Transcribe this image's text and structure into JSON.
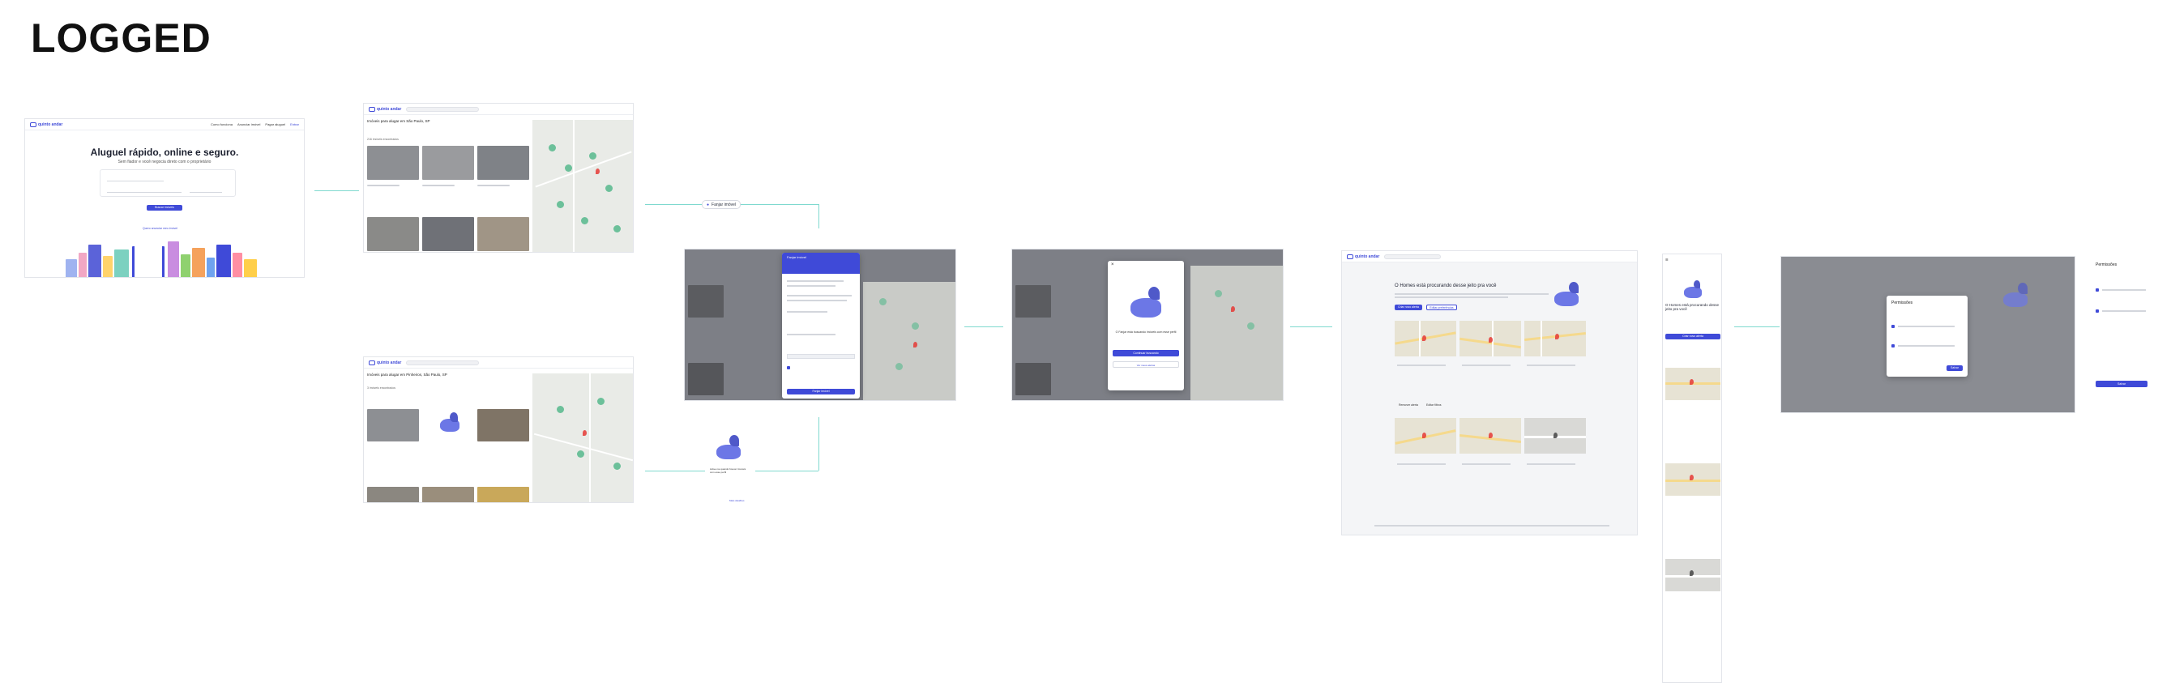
{
  "board": {
    "title": "LOGGED"
  },
  "brand": {
    "logo_text": "quinto andar"
  },
  "landing": {
    "nav": [
      "Como funciona",
      "Anunciar imóvel",
      "Pagar aluguel",
      "Entrar"
    ],
    "hero_title": "Aluguel rápido, online e seguro.",
    "hero_subtitle": "Sem fiador e você negocia direto com o proprietário",
    "cta": "Buscar imóveis",
    "link": "Quero anunciar meu imóvel"
  },
  "listing": {
    "title_a": "Imóveis para alugar em São Paulo, SP",
    "title_b": "Imóveis para alugar em Pinheiros, São Paulo, SP",
    "results_a": "216 imóveis encontrados",
    "results_b": "3 imóveis encontrados"
  },
  "fanpair_tag": {
    "label": "Fanjar imóvel"
  },
  "dog_card": {
    "text": "Avise-me quando houver imóveis com esse perfil",
    "link": "Mais detalhes"
  },
  "modal_filter": {
    "title": "Fanjar imóvel",
    "cta": "Fanjar imóvel"
  },
  "modal_confirm": {
    "text": "O Fanjar está buscando imóveis com esse perfil",
    "cta": "Continuar buscando",
    "secondary": "Ver meus alertas"
  },
  "results_page": {
    "title": "O Homes está procurando desse jeito pra você",
    "btn_primary": "Criar novo alerta",
    "btn_secondary": "Editar preferências",
    "card_actions": [
      "Remover alerta",
      "Editar filtros"
    ]
  },
  "mobile": {
    "title": "O Homes está procurando desse jeito pra você",
    "cta": "Criar novo alerta"
  },
  "permissions": {
    "title": "Permissões",
    "cta": "Salvar"
  },
  "colors": {
    "primary": "#3f4ad8",
    "pin": "#56b98c",
    "connector": "#7fd9cf"
  }
}
